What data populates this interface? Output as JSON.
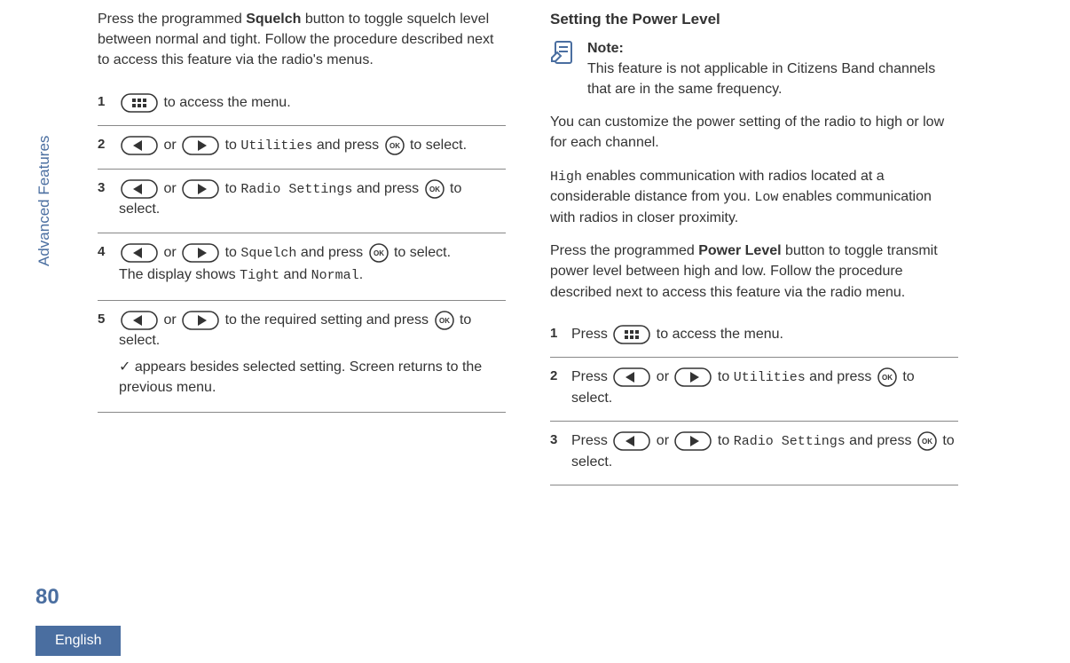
{
  "sidebar": {
    "section": "Advanced Features",
    "page": "80",
    "lang": "English"
  },
  "left": {
    "intro_pre": "Press the programmed ",
    "intro_bold": "Squelch",
    "intro_post": " button to toggle squelch level between normal and tight. Follow the procedure described next to access this feature via the radio's menus.",
    "s1": {
      "num": "1",
      "text": " to access the menu."
    },
    "s2": {
      "num": "2",
      "a": " or ",
      "b": " to ",
      "util": "Utilities",
      "c": " and press ",
      "d": " to select."
    },
    "s3": {
      "num": "3",
      "a": " or ",
      "b": " to ",
      "rs": "Radio Settings",
      "c": " and press ",
      "d": " to select."
    },
    "s4": {
      "num": "4",
      "a": " or ",
      "b": " to ",
      "sq": "Squelch",
      "c": " and press ",
      "d": " to select.",
      "line2a": "The display shows ",
      "tight": "Tight",
      "line2b": " and ",
      "normal": "Normal",
      "line2c": "."
    },
    "s5": {
      "num": "5",
      "a": " or ",
      "b": " to the required setting and press ",
      "c": " to select.",
      "line2": " appears besides selected setting. Screen returns to the previous menu."
    }
  },
  "right": {
    "heading": "Setting the Power Level",
    "note_label": "Note:",
    "note_text": "This feature is not applicable in Citizens Band channels that are in the same frequency.",
    "p1": "You can customize the power setting of the radio to high or low for each channel.",
    "p2a": "High",
    "p2b": " enables communication with radios located at a considerable distance from you. ",
    "p2c": "Low",
    "p2d": " enables communication with radios in closer proximity.",
    "p3a": "Press the programmed ",
    "p3b": "Power Level",
    "p3c": " button to toggle transmit power level between high and low. Follow the procedure described next to access this feature via the radio menu.",
    "s1": {
      "num": "1",
      "a": "Press ",
      "b": " to access the menu."
    },
    "s2": {
      "num": "2",
      "a": "Press ",
      "b": " or ",
      "c": " to ",
      "util": "Utilities",
      "d": " and press ",
      "e": " to select."
    },
    "s3": {
      "num": "3",
      "a": "Press ",
      "b": " or ",
      "c": " to ",
      "rs": "Radio Settings",
      "d": " and press ",
      "e": " to select."
    }
  }
}
